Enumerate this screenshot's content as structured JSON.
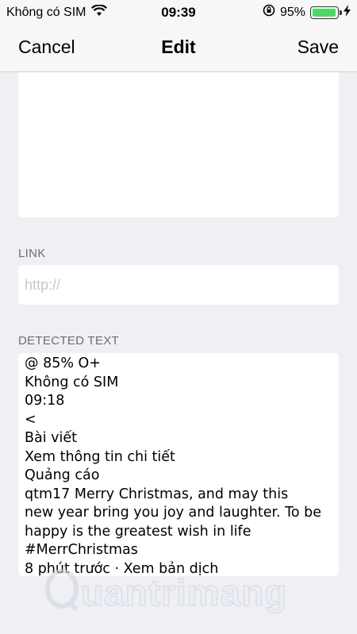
{
  "status_bar": {
    "carrier": "Không có SIM",
    "time": "09:39",
    "battery_percent": "95%",
    "battery_level": 0.95,
    "icons": [
      "wifi-icon",
      "orientation-lock-icon",
      "battery-icon",
      "charging-bolt-icon"
    ],
    "battery_color": "#4cd964"
  },
  "nav": {
    "cancel_label": "Cancel",
    "title": "Edit",
    "save_label": "Save"
  },
  "note": {
    "value": ""
  },
  "link": {
    "label": "LINK",
    "placeholder": "http://",
    "value": ""
  },
  "detected": {
    "label": "DETECTED TEXT",
    "lines": [
      "@ 85% O+",
      "Không có SIM",
      "09:18",
      "<",
      "Bài viết",
      "Xem thông tin chi tiết",
      "Quảng cáo",
      "qtm17 Merry Christmas, and may this",
      "new year bring you joy and laughter. To be",
      "happy is the greatest wish in life",
      "#MerrChristmas",
      "8 phút trước · Xem bản dịch"
    ]
  },
  "watermark": {
    "text": "uantrimang"
  }
}
